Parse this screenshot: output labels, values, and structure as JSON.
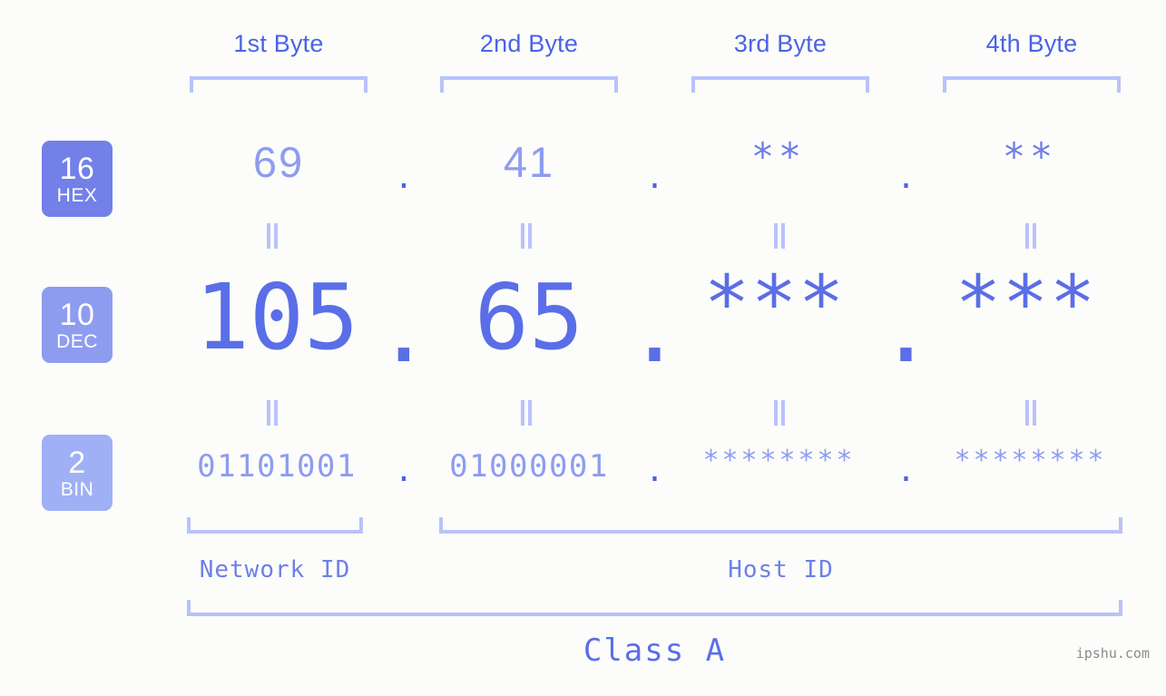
{
  "background_color": "#fcfdfa",
  "accent_colors": {
    "strong_blue": "#4a63e7",
    "mid_blue": "#5a6ee8",
    "light_blue": "#8e9cf0",
    "bracket_blue": "#b9c2fb",
    "badge_hex": "#7280e8",
    "badge_dec": "#8e9cf0",
    "badge_bin": "#9fb0f5",
    "watermark_gray": "#8a8a8a"
  },
  "header": {
    "byte_labels": [
      "1st Byte",
      "2nd Byte",
      "3rd Byte",
      "4th Byte"
    ]
  },
  "bases": [
    {
      "number": "16",
      "name": "HEX"
    },
    {
      "number": "10",
      "name": "DEC"
    },
    {
      "number": "2",
      "name": "BIN"
    }
  ],
  "rows": {
    "hex": {
      "base_number": "16",
      "base_name": "HEX",
      "values": [
        "69",
        "41",
        "**",
        "**"
      ],
      "separator": "."
    },
    "dec": {
      "base_number": "10",
      "base_name": "DEC",
      "values": [
        "105",
        "65",
        "***",
        "***"
      ],
      "separator": "."
    },
    "bin": {
      "base_number": "2",
      "base_name": "BIN",
      "values": [
        "01101001",
        "01000001",
        "********",
        "********"
      ],
      "separator": "."
    }
  },
  "equality_marks": {
    "glyph": "||",
    "count_per_row": 4
  },
  "footer": {
    "network_id_label": "Network ID",
    "host_id_label": "Host ID",
    "class_label": "Class A",
    "watermark": "ipshu.com"
  }
}
